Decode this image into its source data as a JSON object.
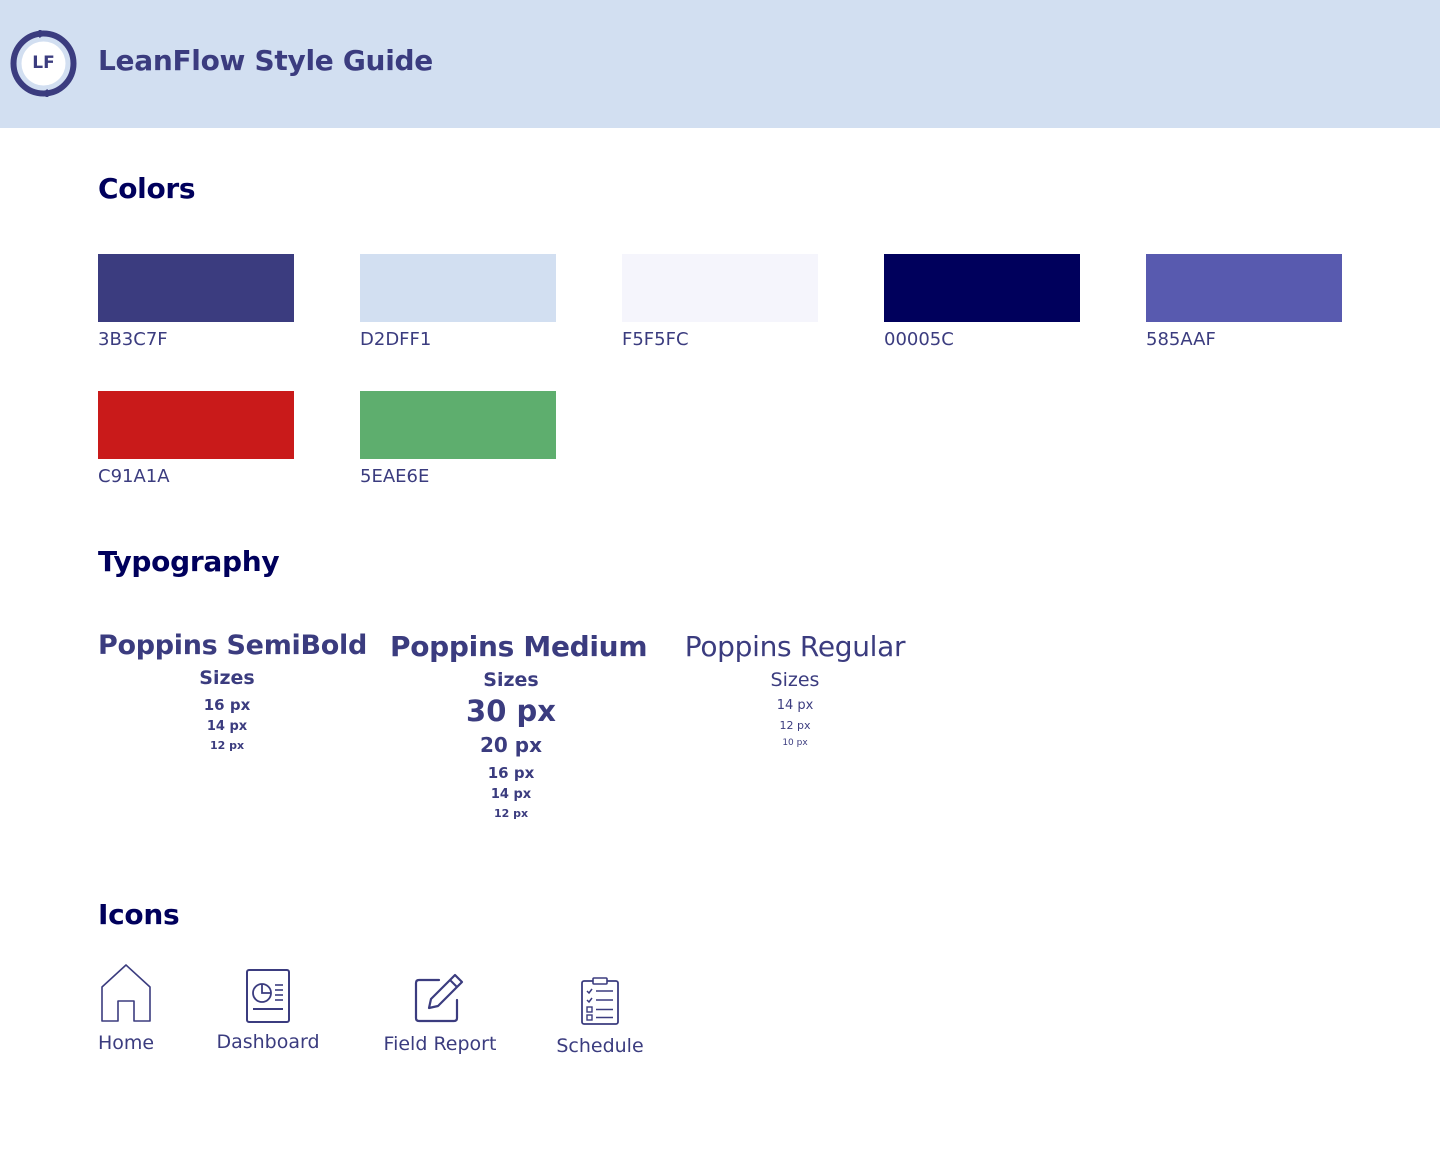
{
  "header": {
    "logo_initials": "LF",
    "title": "LeanFlow Style Guide"
  },
  "colors_section": {
    "title": "Colors",
    "swatches": [
      {
        "hex": "#3B3C7F",
        "label": "3B3C7F"
      },
      {
        "hex": "#D2DFF1",
        "label": "D2DFF1"
      },
      {
        "hex": "#F5F5FC",
        "label": "F5F5FC"
      },
      {
        "hex": "#00005C",
        "label": "00005C"
      },
      {
        "hex": "#585AAF",
        "label": "585AAF"
      },
      {
        "hex": "#C91A1A",
        "label": "C91A1A"
      },
      {
        "hex": "#5EAE6E",
        "label": "5EAE6E"
      }
    ]
  },
  "typography_section": {
    "title": "Typography",
    "fonts": [
      {
        "name": "Poppins SemiBold",
        "sizes_label": "Sizes",
        "sizes": [
          "16 px",
          "14 px",
          "12 px"
        ]
      },
      {
        "name": "Poppins Medium",
        "sizes_label": "Sizes",
        "sizes": [
          "30 px",
          "20 px",
          "16 px",
          "14 px",
          "12 px"
        ]
      },
      {
        "name": "Poppins Regular",
        "sizes_label": "Sizes",
        "sizes": [
          "14 px",
          "12 px",
          "10 px"
        ]
      }
    ]
  },
  "icons_section": {
    "title": "Icons",
    "icons": [
      {
        "icon": "home-icon",
        "label": "Home"
      },
      {
        "icon": "dashboard-icon",
        "label": "Dashboard"
      },
      {
        "icon": "field-report-icon",
        "label": "Field Report"
      },
      {
        "icon": "schedule-icon",
        "label": "Schedule"
      }
    ]
  },
  "theme": {
    "primary": "#3B3C7F",
    "header_bg": "#D2DFF1",
    "heading": "#00005C"
  }
}
